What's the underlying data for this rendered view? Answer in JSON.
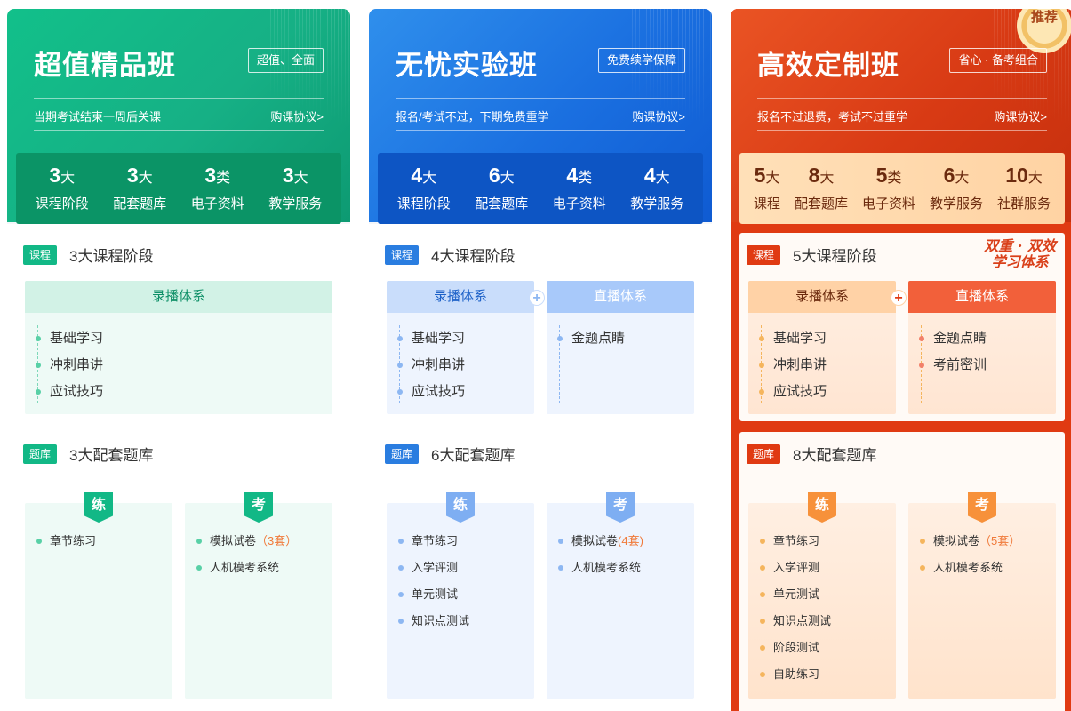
{
  "cards": [
    {
      "title": "超值精品班",
      "tag": "超值、全面",
      "subtitle": "当期考试结束一周后关课",
      "agreement": "购课协议>",
      "stats": [
        {
          "n": "3",
          "u": "大",
          "l": "课程阶段"
        },
        {
          "n": "3",
          "u": "大",
          "l": "配套题库"
        },
        {
          "n": "3",
          "u": "类",
          "l": "电子资料"
        },
        {
          "n": "3",
          "u": "大",
          "l": "教学服务"
        }
      ],
      "course_badge": "课程",
      "course_title": "3大课程阶段",
      "recorded_title": "录播体系",
      "recorded_items": [
        "基础学习",
        "冲刺串讲",
        "应试技巧"
      ],
      "bank_badge": "题库",
      "bank_title": "3大配套题库",
      "practice_flag": "练",
      "practice_items": [
        "章节练习"
      ],
      "exam_flag": "考",
      "exam_items": [
        "模拟试卷",
        "人机模考系统"
      ],
      "exam_count": "（3套）"
    },
    {
      "title": "无忧实验班",
      "tag": "免费续学保障",
      "subtitle": "报名/考试不过，下期免费重学",
      "agreement": "购课协议>",
      "stats": [
        {
          "n": "4",
          "u": "大",
          "l": "课程阶段"
        },
        {
          "n": "6",
          "u": "大",
          "l": "配套题库"
        },
        {
          "n": "4",
          "u": "类",
          "l": "电子资料"
        },
        {
          "n": "4",
          "u": "大",
          "l": "教学服务"
        }
      ],
      "course_badge": "课程",
      "course_title": "4大课程阶段",
      "recorded_title": "录播体系",
      "recorded_items": [
        "基础学习",
        "冲刺串讲",
        "应试技巧"
      ],
      "live_title": "直播体系",
      "live_items": [
        "金题点睛"
      ],
      "bank_badge": "题库",
      "bank_title": "6大配套题库",
      "practice_flag": "练",
      "practice_items": [
        "章节练习",
        "入学评测",
        "单元测试",
        "知识点测试"
      ],
      "exam_flag": "考",
      "exam_items": [
        "模拟试卷",
        "人机模考系统"
      ],
      "exam_count": "(4套)"
    },
    {
      "title": "高效定制班",
      "tag": "省心 · 备考组合",
      "recommend": "推荐",
      "subtitle": "报名不过退费，考试不过重学",
      "agreement": "购课协议>",
      "stats": [
        {
          "n": "5",
          "u": "大",
          "l": "课程"
        },
        {
          "n": "8",
          "u": "大",
          "l": "配套题库"
        },
        {
          "n": "5",
          "u": "类",
          "l": "电子资料"
        },
        {
          "n": "6",
          "u": "大",
          "l": "教学服务"
        },
        {
          "n": "10",
          "u": "大",
          "l": "社群服务"
        }
      ],
      "course_badge": "课程",
      "course_title": "5大课程阶段",
      "slogan_line1": "双重 · 双效",
      "slogan_line2": "学习体系",
      "recorded_title": "录播体系",
      "recorded_items": [
        "基础学习",
        "冲刺串讲",
        "应试技巧"
      ],
      "live_title": "直播体系",
      "live_items": [
        "金题点睛",
        "考前密训"
      ],
      "bank_badge": "题库",
      "bank_title": "8大配套题库",
      "practice_flag": "练",
      "practice_items": [
        "章节练习",
        "入学评测",
        "单元测试",
        "知识点测试",
        "阶段测试",
        "自助练习"
      ],
      "exam_flag": "考",
      "exam_items": [
        "模拟试卷",
        "人机模考系统"
      ],
      "exam_count": "（5套）"
    }
  ]
}
